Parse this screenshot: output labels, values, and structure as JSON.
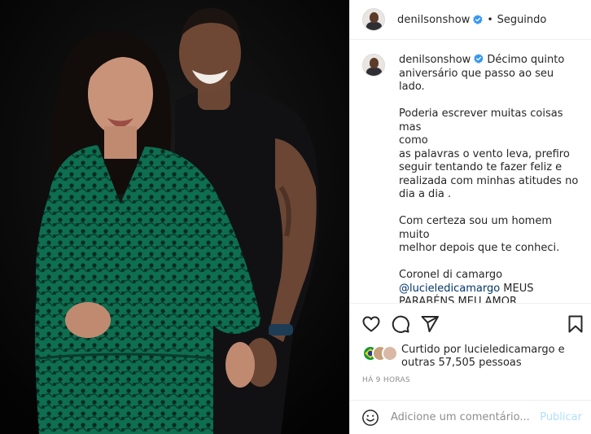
{
  "post": {
    "author": "denilsonshow",
    "follow_status": "Seguindo",
    "separator": "•",
    "photo_alt": "Foto do post"
  },
  "caption": {
    "author": "denilsonshow",
    "text_part1": " Décimo quinto\naniversário que passo ao seu lado.\n\nPoderia escrever muitas coisas mas\ncomo\nas palavras o vento leva, prefiro\nseguir tentando te fazer feliz e\nrealizada com minhas atitudes no\ndia a dia .\n\nCom certeza sou um homem muito\nmelhor depois que te conheci.\n\nCoronel di camargo\n",
    "mention": "@lucieledicamargo",
    "text_part2": " MEUS\nPARABÉNS MEU AMOR , presentaço\no nosso ter vc como\nnamorada/esposa e mãe .\nEu e nossos filhos te amamos"
  },
  "actions": {
    "like_icon": "heart-icon",
    "comment_icon": "comment-icon",
    "share_icon": "share-icon",
    "save_icon": "bookmark-icon"
  },
  "likes": {
    "prefix": "Curtido por ",
    "user": "lucieledicamargo",
    "middle": " e\noutras ",
    "count": "57,505",
    "suffix": " pessoas"
  },
  "timestamp": "HÁ 9 HORAS",
  "comment_input": {
    "placeholder": "Adicione um comentário...",
    "emoji_icon": "smile-icon",
    "publish_label": "Publicar"
  },
  "colors": {
    "verified": "#3897f0",
    "link": "#00376b",
    "publish_disabled": "#b2dffc",
    "muted": "#8e8e8e",
    "dress_green": "#0f7a5a"
  }
}
